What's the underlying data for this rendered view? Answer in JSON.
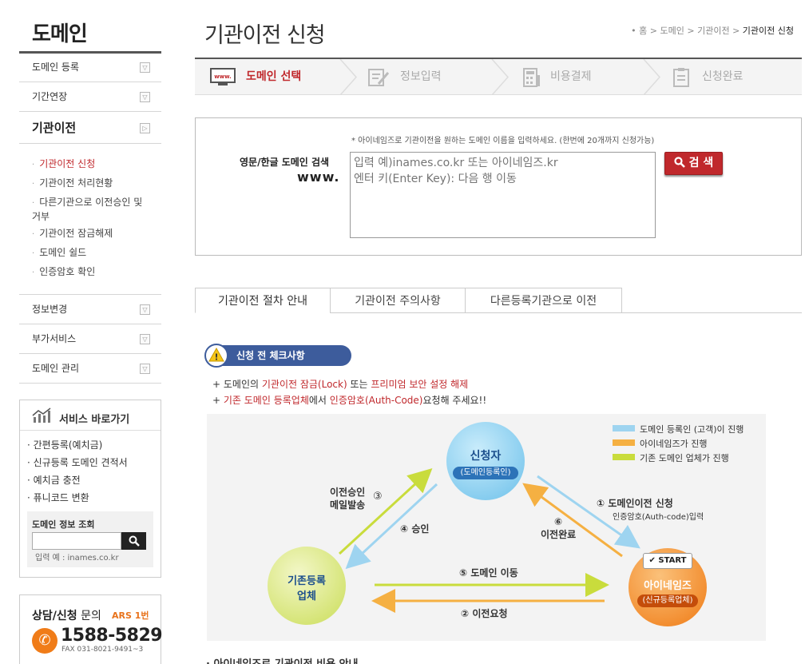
{
  "sidebar": {
    "title": "도메인",
    "menu": [
      {
        "label": "도메인 등록"
      },
      {
        "label": "기간연장"
      },
      {
        "label": "기관이전"
      },
      {
        "label": "정보변경"
      },
      {
        "label": "부가서비스"
      },
      {
        "label": "도메인 관리"
      }
    ],
    "submenu": [
      {
        "label": "기관이전 신청",
        "active": true
      },
      {
        "label": "기관이전 처리현황"
      },
      {
        "label": "다른기관으로 이전승인 및"
      },
      {
        "label": "거부"
      },
      {
        "label": "기관이전 잠금해제"
      },
      {
        "label": "도메인 쉴드"
      },
      {
        "label": "인증암호 확인"
      }
    ],
    "quick": {
      "title": "서비스 바로가기",
      "links": [
        "간편등록(예치금)",
        "신규등록 도메인 견적서",
        "예치금 충전",
        "퓨니코드 변환"
      ],
      "search_label": "도메인 정보 조회",
      "search_example": "입력 예 : inames.co.kr"
    },
    "consult": {
      "title_bold": "상담/신청",
      "title_rest": " 문의",
      "ars": "ARS 1번",
      "phone": "1588-5829",
      "fax": "FAX 031-8021-9491~3"
    }
  },
  "header": {
    "title": "기관이전 신청",
    "breadcrumb": [
      "홈",
      "도메인",
      "기관이전",
      "기관이전 신청"
    ]
  },
  "steps": [
    {
      "label": "도메인 선택",
      "active": true
    },
    {
      "label": "정보입력"
    },
    {
      "label": "비용결제"
    },
    {
      "label": "신청완료"
    }
  ],
  "search": {
    "hint": "* 아이네임즈로 기관이전을 원하는 도메인 이름을 입력하세요. (한번에 20개까지 신청가능)",
    "label": "영문/한글 도메인 검색",
    "www": "www.",
    "placeholder": "입력 예)inames.co.kr 또는 아이네임즈.kr\n엔터 키(Enter Key): 다음 행 이동",
    "button": "검 색"
  },
  "tabs": [
    {
      "label": "기관이전 절차 안내",
      "active": true
    },
    {
      "label": "기관이전 주의사항"
    },
    {
      "label": "다른등록기관으로 이전"
    }
  ],
  "check": {
    "title": "신청 전 체크사항",
    "notes": [
      {
        "parts": [
          "+ 도메인의 ",
          "기관이전 잠금(Lock)",
          " 또는 ",
          "프리미엄 보안 설정 해제",
          ""
        ]
      },
      {
        "parts": [
          "+ ",
          "기존 도메인 등록업체",
          "에서 ",
          "인증암호(Auth-Code)",
          "요청해 주세요!!"
        ]
      }
    ]
  },
  "diagram": {
    "legend": [
      {
        "label": "도메인 등록인 (고객)이 진행",
        "color": "#9ed4f0"
      },
      {
        "label": "아이네임즈가 진행",
        "color": "#f5b042"
      },
      {
        "label": "기존 도메인 업체가 진행",
        "color": "#c9dc3c"
      }
    ],
    "nodes": {
      "applicant": {
        "name": "신청자",
        "sub": "(도메인등록인)"
      },
      "old": {
        "name": "기존등록",
        "name2": "업체"
      },
      "inames": {
        "name": "아이네임즈",
        "sub": "(신규등록업체)",
        "badge": "START"
      }
    },
    "flows": [
      {
        "num": "①",
        "label": "도메인이전 신청",
        "sub": "인증암호(Auth-code)입력"
      },
      {
        "num": "②",
        "label": "이전요청"
      },
      {
        "num": "③",
        "label": "이전승인",
        "label2": "메일발송"
      },
      {
        "num": "④",
        "label": "승인"
      },
      {
        "num": "⑤",
        "label": "도메인 이동"
      },
      {
        "num": "⑥",
        "label": "이전완료"
      }
    ]
  },
  "bottom_heading": "· 아이네임즈로 기관이전 비용 안내"
}
